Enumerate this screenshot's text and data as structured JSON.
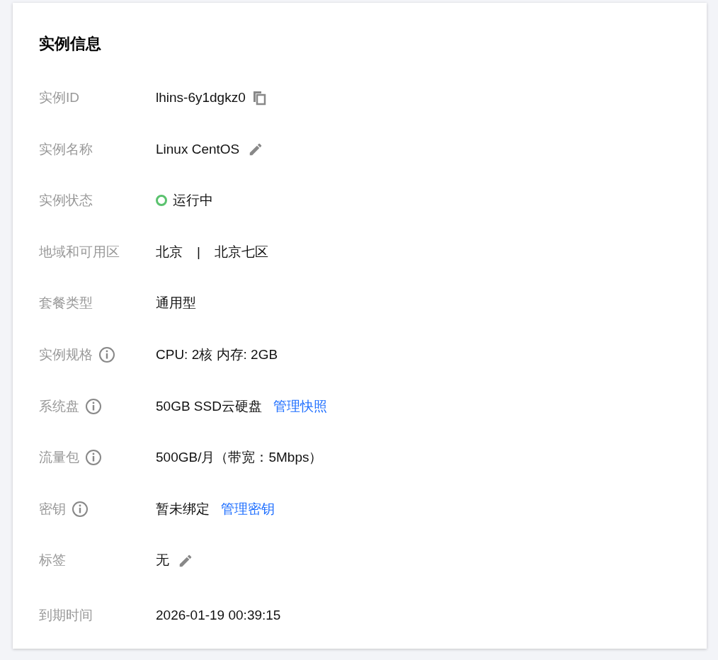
{
  "card": {
    "title": "实例信息",
    "rows": [
      {
        "label": "实例ID",
        "info": false,
        "kind": "copy",
        "value": "lhins-6y1dgkz0"
      },
      {
        "label": "实例名称",
        "info": false,
        "kind": "edit",
        "value": "Linux CentOS"
      },
      {
        "label": "实例状态",
        "info": false,
        "kind": "status",
        "value": "运行中"
      },
      {
        "label": "地域和可用区",
        "info": false,
        "kind": "region",
        "values": [
          "北京",
          "北京七区"
        ],
        "separator": "|"
      },
      {
        "label": "套餐类型",
        "info": false,
        "kind": "text",
        "value": "通用型"
      },
      {
        "label": "实例规格",
        "info": true,
        "kind": "text",
        "value": "CPU: 2核 内存: 2GB"
      },
      {
        "label": "系统盘",
        "info": true,
        "kind": "link",
        "value": "50GB SSD云硬盘",
        "link": "管理快照"
      },
      {
        "label": "流量包",
        "info": true,
        "kind": "text",
        "value": "500GB/月（带宽：5Mbps）"
      },
      {
        "label": "密钥",
        "info": true,
        "kind": "link",
        "value": "暂未绑定",
        "link": "管理密钥"
      },
      {
        "label": "标签",
        "info": false,
        "kind": "edit",
        "value": "无"
      },
      {
        "label": "到期时间",
        "info": false,
        "kind": "text",
        "value": "2026-01-19 00:39:15"
      }
    ]
  }
}
